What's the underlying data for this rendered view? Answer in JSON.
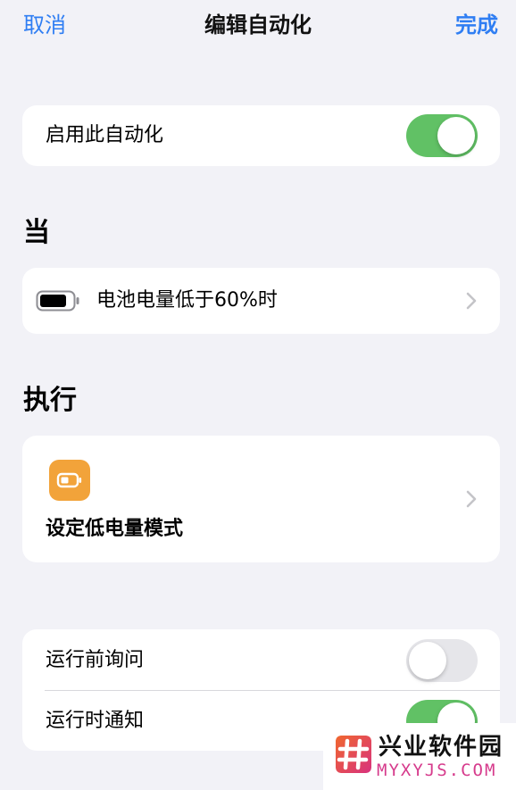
{
  "nav": {
    "cancel": "取消",
    "title": "编辑自动化",
    "done": "完成"
  },
  "enable": {
    "label": "启用此自动化",
    "toggle_on": true
  },
  "when": {
    "section_title": "当",
    "trigger_label": "电池电量低于60%时",
    "icon": "battery-icon"
  },
  "do": {
    "section_title": "执行",
    "action_label": "设定低电量模式",
    "icon": "low-power-mode-icon",
    "icon_color": "#f2a33a"
  },
  "options": {
    "ask_before_running": {
      "label": "运行前询问",
      "toggle_on": false
    },
    "notify_when_run": {
      "label": "运行时通知",
      "toggle_on": true
    }
  },
  "watermark": {
    "name": "兴业软件园",
    "domain": "MYXYJS.COM"
  },
  "colors": {
    "accent": "#2f7ef3",
    "toggle_on": "#61c165",
    "toggle_off": "#e6e6ea",
    "background": "#f2f2f7"
  }
}
